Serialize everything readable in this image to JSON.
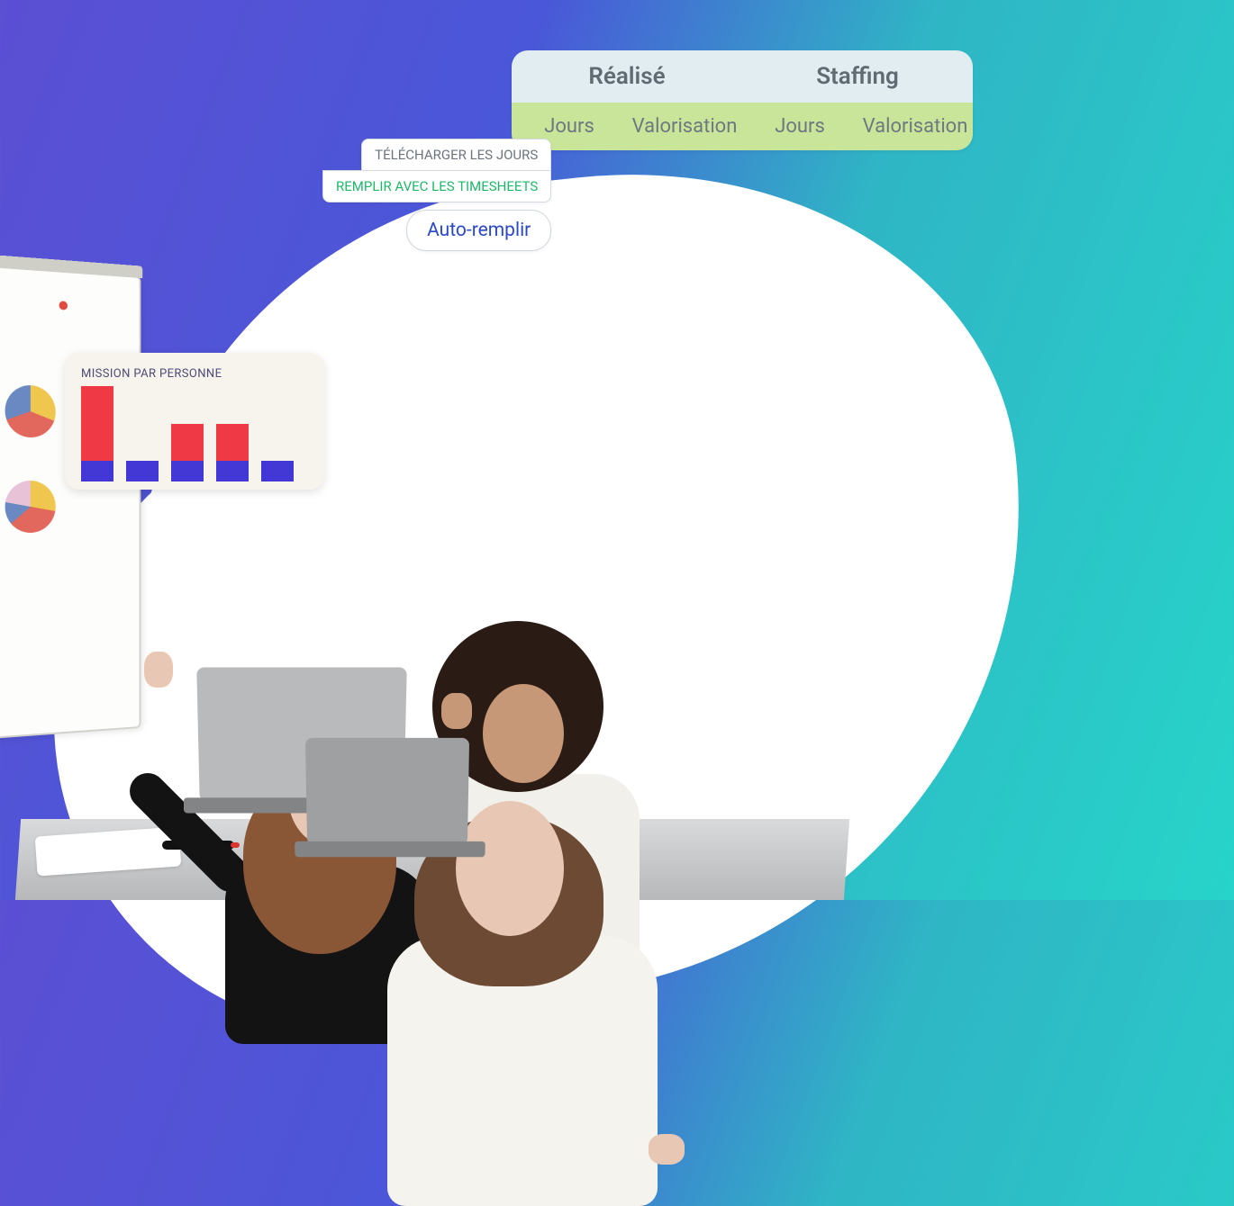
{
  "table": {
    "header_left": "Réalisé",
    "header_right": "Staffing",
    "sub_jours": "Jours",
    "sub_valorisation": "Valorisation"
  },
  "actions": {
    "download_days": "TÉLÉCHARGER LES JOURS",
    "fill_timesheets": "REMPLIR AVEC LES TIMESHEETS",
    "auto_fill": "Auto-remplir"
  },
  "mission_card": {
    "title": "MISSION PAR PERSONNE"
  },
  "chart_data": {
    "type": "bar",
    "title": "MISSION PAR PERSONNE",
    "categories": [
      "c1",
      "c2",
      "c3",
      "c4",
      "c5"
    ],
    "series": [
      {
        "name": "red",
        "color": "#ef3945",
        "values": [
          80,
          0,
          40,
          40,
          0
        ]
      },
      {
        "name": "blue",
        "color": "#4337d6",
        "values": [
          22,
          22,
          22,
          22,
          22
        ]
      }
    ],
    "ylim": [
      0,
      100
    ],
    "note": "values are relative bar heights read from the thumbnail; no axis labels are visible"
  }
}
